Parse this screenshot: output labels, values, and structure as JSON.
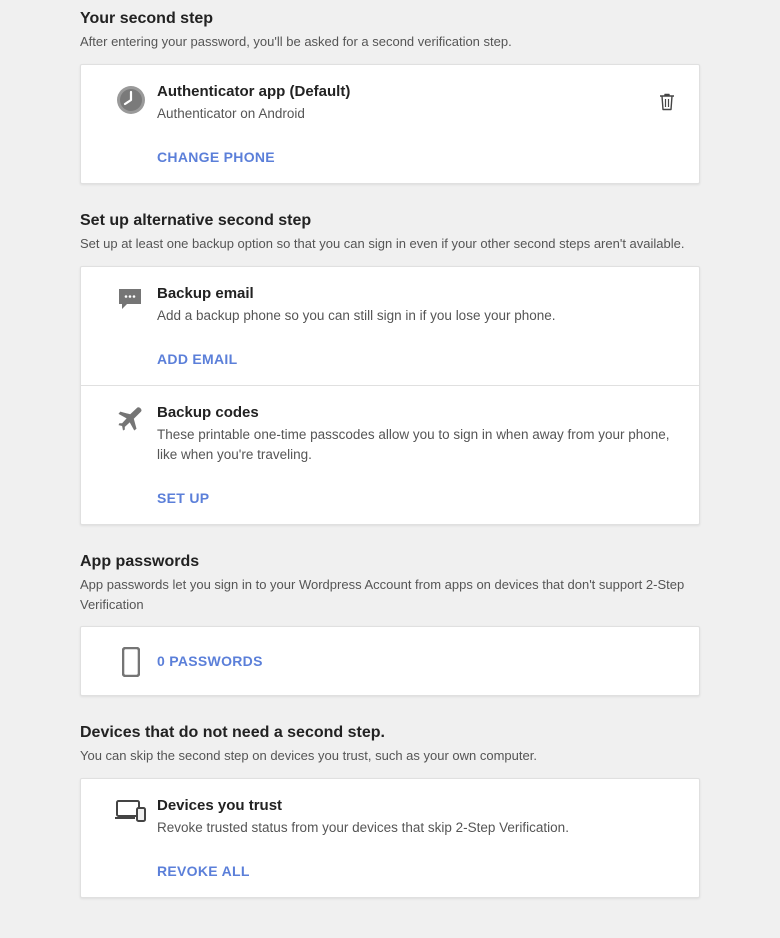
{
  "second_step": {
    "title": "Your second step",
    "subtitle": "After entering your password, you'll be asked for a second verification step.",
    "auth_app": {
      "title": "Authenticator app (Default)",
      "desc": "Authenticator on Android",
      "action": "CHANGE PHONE"
    }
  },
  "alternative": {
    "title": "Set up alternative second step",
    "subtitle": "Set up at least one backup option so that you can sign in even if your other second steps aren't available.",
    "backup_email": {
      "title": "Backup email",
      "desc": "Add a backup phone so you can still sign in if you lose your phone.",
      "action": "ADD EMAIL"
    },
    "backup_codes": {
      "title": "Backup codes",
      "desc": "These printable one-time passcodes allow you to sign in when away from your phone, like when you're traveling.",
      "action": "SET UP"
    }
  },
  "app_passwords": {
    "title": "App passwords",
    "subtitle": "App passwords let you sign in to your Wordpress Account from apps on devices that don't support 2-Step Verification",
    "link": "0 PASSWORDS"
  },
  "trusted_devices": {
    "title": "Devices that do not need a second step.",
    "subtitle": "You can skip the second step on devices you trust, such as your own computer.",
    "card": {
      "title": "Devices you trust",
      "desc": "Revoke trusted status from your devices that skip 2-Step Verification.",
      "action": "REVOKE ALL"
    }
  }
}
